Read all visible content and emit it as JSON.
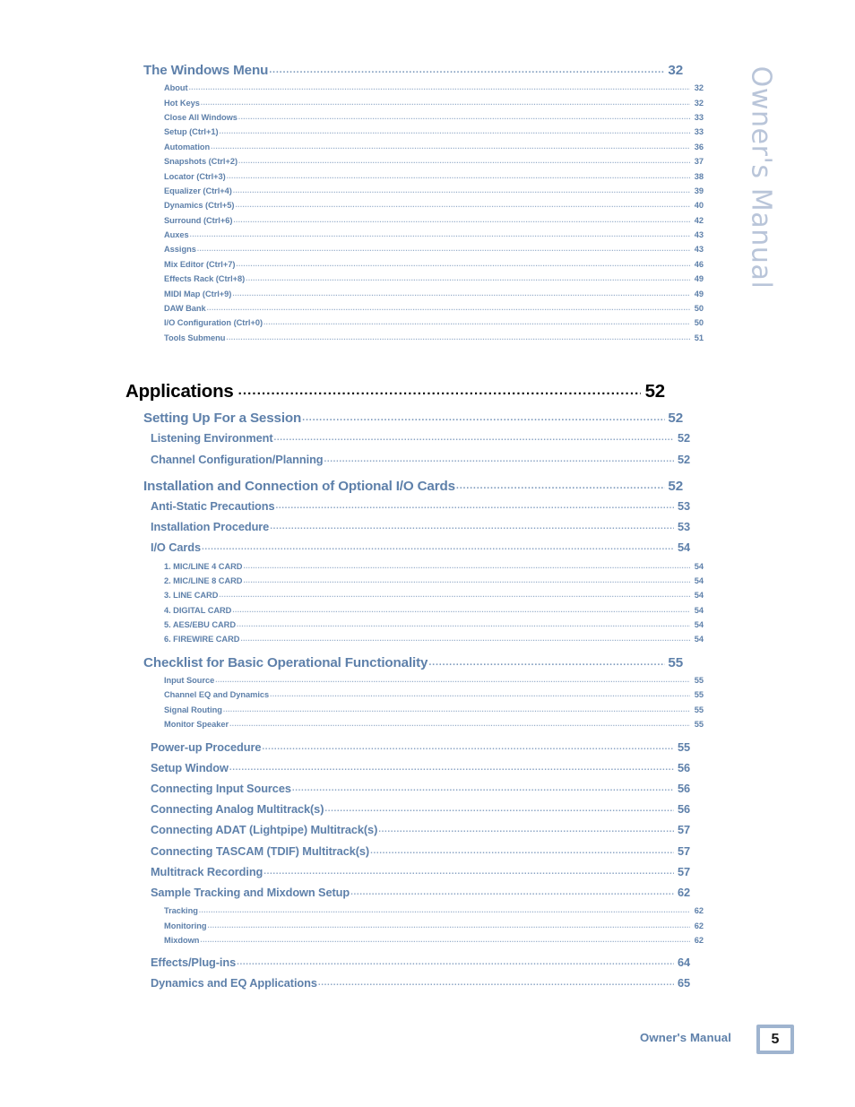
{
  "side_tab": {
    "text": "Owner's Manual"
  },
  "footer": {
    "label": "Owner's Manual",
    "page_number": "5"
  },
  "colors": {
    "heading_blue": "#5e80aa",
    "leader_blue": "#8aa4c4",
    "part_black": "#000000",
    "side_tab": "#b9c5d9",
    "badge_border": "#9fb4cf"
  },
  "toc": {
    "entries": [
      {
        "level": 1,
        "title": "The Windows Menu",
        "page": "32"
      },
      {
        "level": 3,
        "title": "About",
        "page": "32"
      },
      {
        "level": 3,
        "title": "Hot Keys",
        "page": "32"
      },
      {
        "level": 3,
        "title": "Close All Windows",
        "page": "33"
      },
      {
        "level": 3,
        "title": "Setup (Ctrl+1)",
        "page": "33"
      },
      {
        "level": 3,
        "title": "Automation",
        "page": "36"
      },
      {
        "level": 3,
        "title": "Snapshots (Ctrl+2)",
        "page": "37"
      },
      {
        "level": 3,
        "title": "Locator (Ctrl+3)",
        "page": "38"
      },
      {
        "level": 3,
        "title": "Equalizer (Ctrl+4)",
        "page": "39"
      },
      {
        "level": 3,
        "title": "Dynamics (Ctrl+5)",
        "page": "40"
      },
      {
        "level": 3,
        "title": "Surround (Ctrl+6)",
        "page": "42"
      },
      {
        "level": 3,
        "title": "Auxes",
        "page": "43"
      },
      {
        "level": 3,
        "title": "Assigns",
        "page": "43"
      },
      {
        "level": 3,
        "title": "Mix Editor (Ctrl+7)",
        "page": "46"
      },
      {
        "level": 3,
        "title": "Effects Rack (Ctrl+8)",
        "page": "49"
      },
      {
        "level": 3,
        "title": "MIDI Map (Ctrl+9)",
        "page": "49"
      },
      {
        "level": 3,
        "title": "DAW Bank",
        "page": "50"
      },
      {
        "level": 3,
        "title": "I/O Configuration (Ctrl+0)",
        "page": "50"
      },
      {
        "level": 3,
        "title": "Tools Submenu",
        "page": "51"
      },
      {
        "level": 0,
        "title": "Applications",
        "page": "52"
      },
      {
        "level": 1,
        "title": "Setting Up For a Session",
        "page": "52"
      },
      {
        "level": 2,
        "title": "Listening Environment",
        "page": "52"
      },
      {
        "level": 2,
        "title": "Channel Configuration/Planning",
        "page": "52"
      },
      {
        "level": 1,
        "title": "Installation and Connection of Optional I/O Cards",
        "page": "52"
      },
      {
        "level": 2,
        "title": "Anti-Static Precautions",
        "page": "53"
      },
      {
        "level": 2,
        "title": "Installation Procedure",
        "page": "53"
      },
      {
        "level": 2,
        "title": "I/O Cards",
        "page": "54"
      },
      {
        "level": 3,
        "title": "1. MIC/LINE 4 CARD",
        "page": "54"
      },
      {
        "level": 3,
        "title": "2. MIC/LINE 8 CARD",
        "page": "54"
      },
      {
        "level": 3,
        "title": "3. LINE CARD",
        "page": "54"
      },
      {
        "level": 3,
        "title": "4. DIGITAL CARD",
        "page": "54"
      },
      {
        "level": 3,
        "title": "5. AES/EBU CARD",
        "page": "54"
      },
      {
        "level": 3,
        "title": "6. FIREWIRE CARD",
        "page": "54"
      },
      {
        "level": 1,
        "title": "Checklist for Basic Operational Functionality",
        "page": "55"
      },
      {
        "level": 3,
        "title": "Input Source",
        "page": "55"
      },
      {
        "level": 3,
        "title": "Channel EQ and Dynamics",
        "page": "55"
      },
      {
        "level": 3,
        "title": "Signal Routing",
        "page": "55"
      },
      {
        "level": 3,
        "title": "Monitor Speaker",
        "page": "55"
      },
      {
        "level": 2,
        "title": "Power-up Procedure",
        "page": "55"
      },
      {
        "level": 2,
        "title": "Setup Window",
        "page": "56"
      },
      {
        "level": 2,
        "title": "Connecting Input Sources",
        "page": "56"
      },
      {
        "level": 2,
        "title": "Connecting Analog Multitrack(s)",
        "page": "56"
      },
      {
        "level": 2,
        "title": "Connecting ADAT (Lightpipe) Multitrack(s)",
        "page": "57"
      },
      {
        "level": 2,
        "title": "Connecting TASCAM (TDIF) Multitrack(s)",
        "page": "57"
      },
      {
        "level": 2,
        "title": "Multitrack Recording",
        "page": "57"
      },
      {
        "level": 2,
        "title": "Sample Tracking and Mixdown Setup",
        "page": "62"
      },
      {
        "level": 3,
        "title": "Tracking",
        "page": "62"
      },
      {
        "level": 3,
        "title": "Monitoring",
        "page": "62"
      },
      {
        "level": 3,
        "title": "Mixdown",
        "page": "62"
      },
      {
        "level": 2,
        "title": "Effects/Plug-ins",
        "page": "64"
      },
      {
        "level": 2,
        "title": "Dynamics and EQ Applications",
        "page": "65"
      }
    ]
  }
}
